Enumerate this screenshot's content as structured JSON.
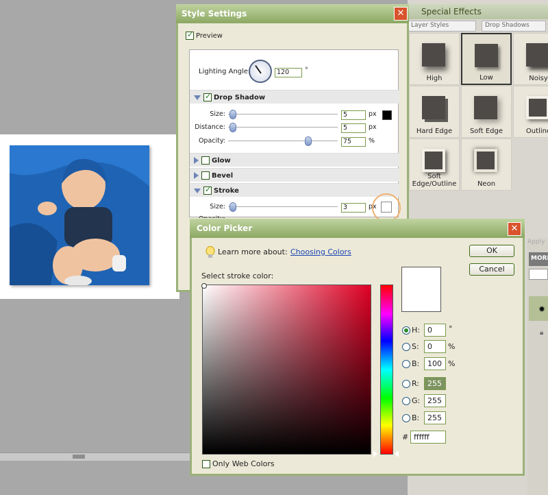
{
  "effects_panel": {
    "title": "Special Effects",
    "category_select": "Layer Styles",
    "type_select": "Drop Shadows",
    "apply_label": "Apply",
    "more_label": "MORE",
    "items": [
      {
        "label": "High",
        "selected": false
      },
      {
        "label": "Low",
        "selected": true
      },
      {
        "label": "Noisy",
        "selected": false
      },
      {
        "label": "Hard Edge",
        "selected": false
      },
      {
        "label": "Soft Edge",
        "selected": false
      },
      {
        "label": "Outline",
        "selected": false
      },
      {
        "label": "Soft Edge/Outline",
        "selected": false
      },
      {
        "label": "Neon",
        "selected": false
      }
    ]
  },
  "style_settings": {
    "title": "Style Settings",
    "preview_label": "Preview",
    "lighting_label": "Lighting Angle:",
    "lighting_value": "120",
    "lighting_unit": "°",
    "drop_shadow": {
      "label": "Drop Shadow",
      "size_label": "Size:",
      "size_value": "5",
      "size_unit": "px",
      "distance_label": "Distance:",
      "distance_value": "5",
      "distance_unit": "px",
      "opacity_label": "Opacity:",
      "opacity_value": "75",
      "opacity_unit": "%"
    },
    "glow_label": "Glow",
    "bevel_label": "Bevel",
    "stroke": {
      "label": "Stroke",
      "size_label": "Size:",
      "size_value": "3",
      "size_unit": "px",
      "opacity_label": "Opacity:"
    }
  },
  "color_picker": {
    "title": "Color Picker",
    "learn_label": "Learn more about:",
    "learn_link": "Choosing Colors",
    "ok_label": "OK",
    "cancel_label": "Cancel",
    "select_label": "Select stroke color:",
    "fields": {
      "h": {
        "label": "H:",
        "value": "0",
        "unit": "°"
      },
      "s": {
        "label": "S:",
        "value": "0",
        "unit": "%"
      },
      "b": {
        "label": "B:",
        "value": "100",
        "unit": "%"
      },
      "r": {
        "label": "R:",
        "value": "255"
      },
      "g": {
        "label": "G:",
        "value": "255"
      },
      "bl": {
        "label": "B:",
        "value": "255"
      }
    },
    "hex_label": "#",
    "hex_value": "ffffff",
    "web_colors_label": "Only Web Colors"
  }
}
